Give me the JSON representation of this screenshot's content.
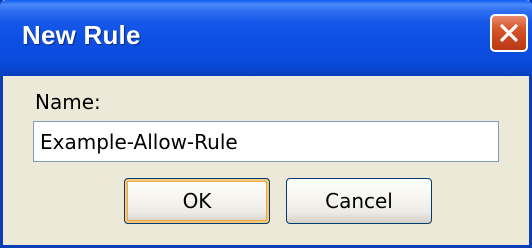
{
  "dialog": {
    "title": "New Rule",
    "close_icon": "close-icon",
    "colors": {
      "titlebar": "#0b4bdc",
      "close_button": "#d8582f",
      "background": "#ece9d8"
    }
  },
  "form": {
    "name_label": "Name:",
    "name_value": "Example-Allow-Rule"
  },
  "buttons": {
    "ok_label": "OK",
    "cancel_label": "Cancel"
  }
}
